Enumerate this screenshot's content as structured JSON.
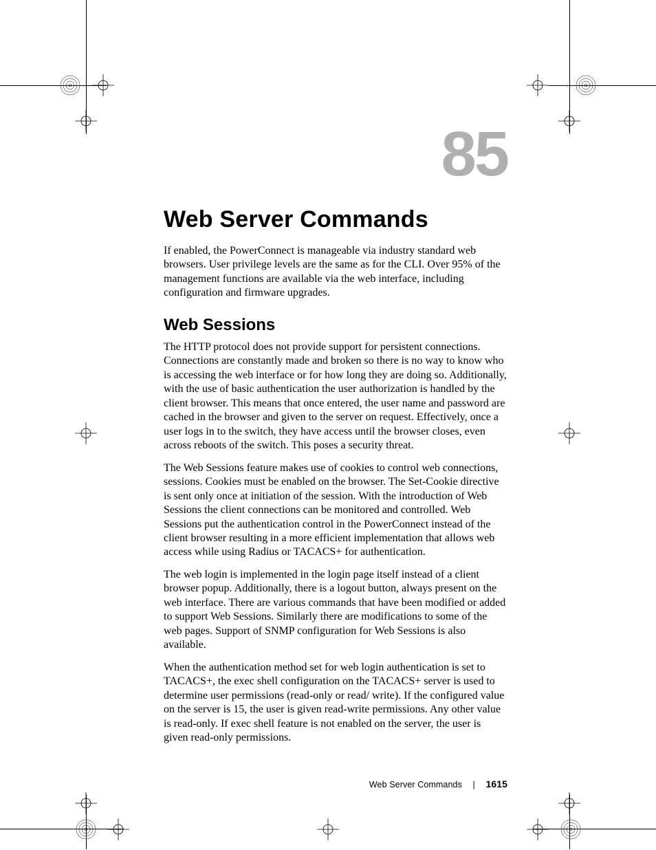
{
  "chapter": {
    "number": "85",
    "title": "Web Server Commands",
    "intro": "If enabled, the PowerConnect is manageable via industry standard web browsers. User privilege levels are the same as for the CLI. Over 95% of the management functions are available via the web interface, including configuration and firmware upgrades."
  },
  "section": {
    "title": "Web Sessions",
    "paragraphs": [
      "The HTTP protocol does not provide support for persistent connections. Connections are constantly made and broken so there is no way to know who is accessing the web interface or for how long they are doing so. Additionally, with the use of basic authentication the user authorization is handled by the client browser. This means that once entered, the user name and password are cached in the browser and given to the server on request. Effectively, once a user logs in to the switch, they have access until the browser closes, even across reboots of the switch. This poses a security threat.",
      "The Web Sessions feature makes use of cookies to control web connections, sessions. Cookies must be enabled on the browser. The Set-Cookie directive is sent only once at initiation of the session. With the introduction of Web Sessions the client connections can be monitored and controlled. Web Sessions put the authentication control in the PowerConnect instead of the client browser resulting in a more efficient implementation that allows web access while using Radius or TACACS+ for authentication.",
      "The web login is implemented in the login page itself instead of a client browser popup. Additionally, there is a logout button, always present on the web interface. There are various commands that have been modified or added to support Web Sessions. Similarly there are modifications to some of the web pages. Support of SNMP configuration for Web Sessions is also available.",
      "When the authentication method set for web login authentication is set to TACACS+, the exec shell configuration on the TACACS+ server is used to determine user permissions (read-only or read/ write). If the configured value on the server is 15, the user is given read-write permissions. Any other value is read-only. If exec shell feature is not enabled on the server, the user is given read-only permissions."
    ]
  },
  "footer": {
    "section_label": "Web Server Commands",
    "page_number": "1615"
  }
}
